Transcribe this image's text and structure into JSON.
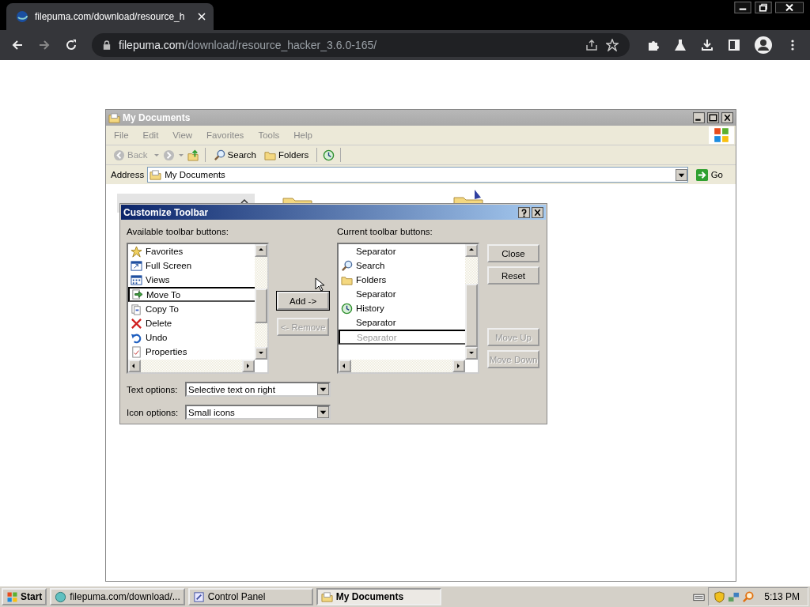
{
  "browser": {
    "tab_title": "filepuma.com/download/resource_h",
    "url_host": "filepuma.com",
    "url_path": "/download/resource_hacker_3.6.0-165/"
  },
  "explorer": {
    "title": "My Documents",
    "menu": [
      "File",
      "Edit",
      "View",
      "Favorites",
      "Tools",
      "Help"
    ],
    "toolbar": [
      {
        "kind": "back",
        "label": "Back"
      },
      {
        "kind": "forward"
      },
      {
        "kind": "up"
      },
      {
        "kind": "search",
        "label": "Search"
      },
      {
        "kind": "folders",
        "label": "Folders"
      },
      {
        "kind": "history"
      }
    ],
    "address_label": "Address",
    "address": "My Documents",
    "go": "Go"
  },
  "dialog": {
    "title": "Customize Toolbar",
    "available_label": "Available toolbar buttons:",
    "available": [
      {
        "label": "Favorites",
        "selected": false
      },
      {
        "label": "Full Screen",
        "selected": false
      },
      {
        "label": "Views",
        "selected": false
      },
      {
        "label": "Move To",
        "selected": true
      },
      {
        "label": "Copy To",
        "selected": false
      },
      {
        "label": "Delete",
        "selected": false
      },
      {
        "label": "Undo",
        "selected": false
      },
      {
        "label": "Properties",
        "selected": false
      }
    ],
    "add": {
      "label": "Add ->",
      "disabled": false
    },
    "remove": {
      "label": "<- Remove",
      "disabled": true
    },
    "current_label": "Current toolbar buttons:",
    "current": [
      {
        "label": "Separator",
        "selected": false,
        "disabled": false
      },
      {
        "label": "Search",
        "selected": false,
        "disabled": false
      },
      {
        "label": "Folders",
        "selected": false,
        "disabled": false
      },
      {
        "label": "Separator",
        "selected": false,
        "disabled": false
      },
      {
        "label": "History",
        "selected": false,
        "disabled": false
      },
      {
        "label": "Separator",
        "selected": false,
        "disabled": false
      },
      {
        "label": "Separator",
        "selected": true,
        "disabled": true
      }
    ],
    "buttons": [
      {
        "label": "Close",
        "disabled": false
      },
      {
        "label": "Reset",
        "disabled": false
      },
      {
        "label": "Move Up",
        "disabled": true
      },
      {
        "label": "Move Down",
        "disabled": true
      }
    ],
    "text_options_label": "Text options:",
    "text_options": "Selective text on right",
    "icon_options_label": "Icon options:",
    "icon_options": "Small icons"
  },
  "taskbar": {
    "start": "Start",
    "tasks": [
      {
        "label": "filepuma.com/download/...",
        "selected": false
      },
      {
        "label": "Control Panel",
        "selected": false
      },
      {
        "label": "My Documents",
        "selected": true
      }
    ],
    "clock": "5:13 PM"
  }
}
